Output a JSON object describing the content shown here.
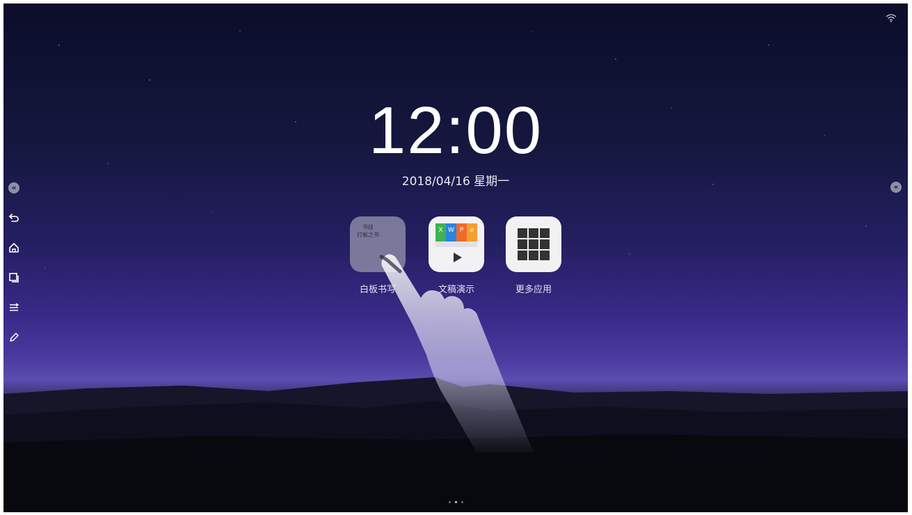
{
  "status": {
    "wifi_icon": "wifi-icon"
  },
  "clock": {
    "time": "12:00",
    "date": "2018/04/16  星期一"
  },
  "apps": [
    {
      "label": "白板书写",
      "icon": "whiteboard-icon",
      "tile_text": [
        "书技",
        "打板之书"
      ]
    },
    {
      "label": "文稿演示",
      "icon": "presentation-icon",
      "tile_letters": [
        "X",
        "W",
        "P",
        "ℯ"
      ]
    },
    {
      "label": "更多应用",
      "icon": "app-grid-icon"
    }
  ],
  "sidebar": {
    "items": [
      {
        "icon": "collapse-left-icon",
        "text": "«"
      },
      {
        "icon": "back-icon"
      },
      {
        "icon": "home-icon"
      },
      {
        "icon": "multitask-icon"
      },
      {
        "icon": "settings-sliders-icon"
      },
      {
        "icon": "pen-icon"
      }
    ]
  },
  "right_collapse": {
    "icon": "collapse-right-icon",
    "text": "«"
  },
  "pager": {
    "count": 3,
    "active": 1
  },
  "colors": {
    "sky_top": "#0b0d2a",
    "sky_horizon": "#5a4db0",
    "text": "#ffffff"
  }
}
